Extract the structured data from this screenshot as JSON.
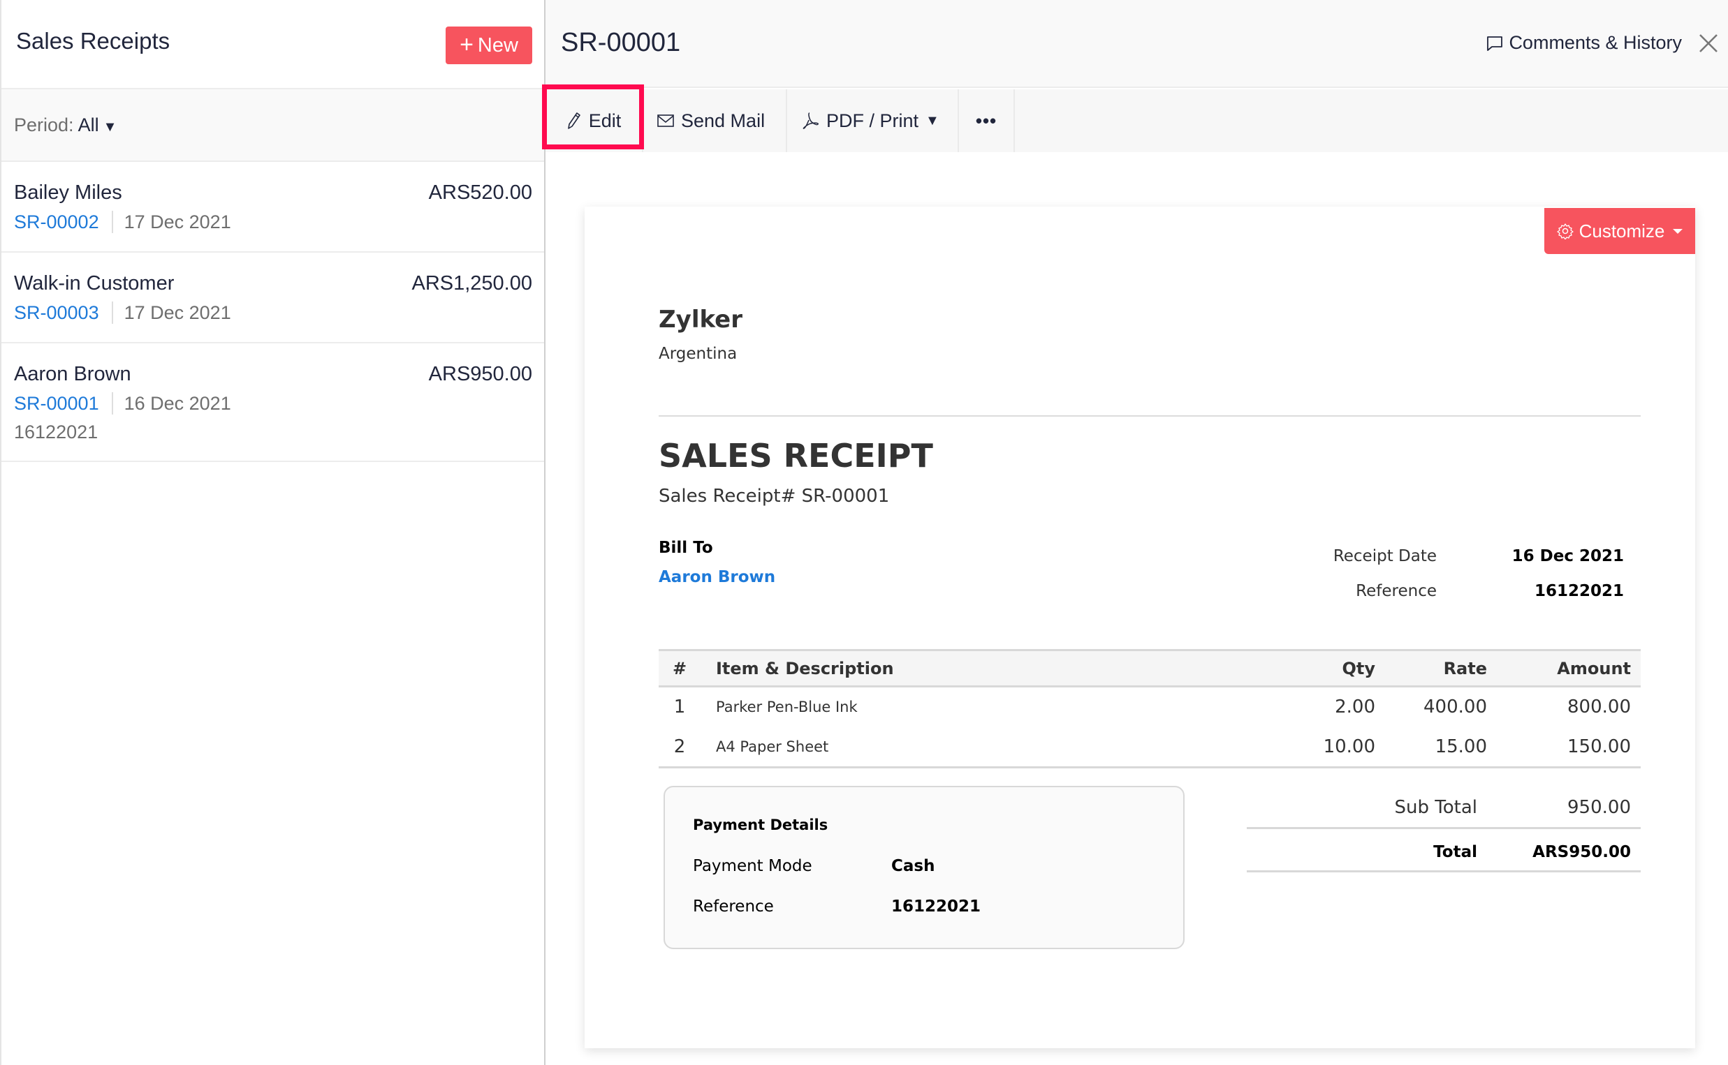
{
  "left_panel": {
    "title": "Sales Receipts",
    "new_button": {
      "icon": "plus-icon",
      "label": "New"
    },
    "filter": {
      "label": "Period:",
      "value": "All"
    },
    "receipts": [
      {
        "customer": "Bailey Miles",
        "amount": "ARS520.00",
        "number": "SR-00002",
        "date": "17 Dec 2021",
        "reference": ""
      },
      {
        "customer": "Walk-in Customer",
        "amount": "ARS1,250.00",
        "number": "SR-00003",
        "date": "17 Dec 2021",
        "reference": ""
      },
      {
        "customer": "Aaron Brown",
        "amount": "ARS950.00",
        "number": "SR-00001",
        "date": "16 Dec 2021",
        "reference": "16122021"
      }
    ]
  },
  "detail": {
    "title": "SR-00001",
    "comments_label": "Comments & History",
    "toolbar": {
      "edit": "Edit",
      "send_mail": "Send Mail",
      "pdf_print": "PDF / Print",
      "more": "•••"
    },
    "customize_label": "Customize",
    "document": {
      "company": "Zylker",
      "country": "Argentina",
      "doc_type": "SALES RECEIPT",
      "doc_number": "Sales Receipt# SR-00001",
      "bill_to_label": "Bill To",
      "bill_to_name": "Aaron Brown",
      "meta": [
        {
          "label": "Receipt Date",
          "value": "16 Dec 2021"
        },
        {
          "label": "Reference",
          "value": "16122021"
        }
      ],
      "columns": [
        "#",
        "Item & Description",
        "Qty",
        "Rate",
        "Amount"
      ],
      "items": [
        {
          "num": "1",
          "description": "Parker Pen-Blue Ink",
          "qty": "2.00",
          "rate": "400.00",
          "amount": "800.00"
        },
        {
          "num": "2",
          "description": "A4 Paper Sheet",
          "qty": "10.00",
          "rate": "15.00",
          "amount": "150.00"
        }
      ],
      "payment": {
        "title": "Payment Details",
        "mode_label": "Payment Mode",
        "mode_value": "Cash",
        "reference_label": "Reference",
        "reference_value": "16122021"
      },
      "totals": {
        "subtotal_label": "Sub Total",
        "subtotal_value": "950.00",
        "total_label": "Total",
        "total_value": "ARS950.00"
      }
    }
  },
  "colors": {
    "accent_red": "#f7545e",
    "link_blue": "#1e7ad9",
    "highlight": "#ff0a4f"
  }
}
